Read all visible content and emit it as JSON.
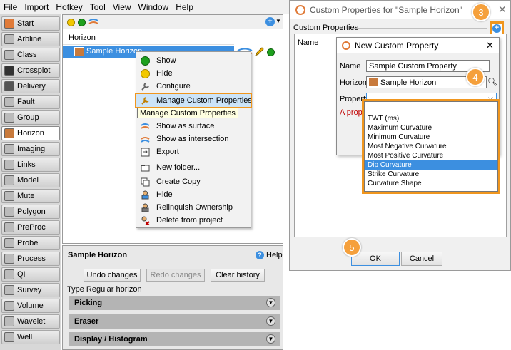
{
  "menubar": {
    "items": [
      "File",
      "Import",
      "Hotkey",
      "Tool",
      "View",
      "Window",
      "Help"
    ]
  },
  "tools": [
    "Start",
    "Arbline",
    "Class",
    "Crossplot",
    "Delivery",
    "Fault",
    "Group",
    "Horizon",
    "Imaging",
    "Links",
    "Model",
    "Mute",
    "Polygon",
    "PreProc",
    "Probe",
    "Process",
    "QI",
    "Survey",
    "Volume",
    "Wavelet",
    "Well"
  ],
  "selected_tool": "Horizon",
  "horizon_panel": {
    "column_header": "Horizon",
    "item_name": "Sample Horizon"
  },
  "context_menu": {
    "items": [
      {
        "label": "Show",
        "icon": "green-dot-icon"
      },
      {
        "label": "Hide",
        "icon": "yellow-dot-icon"
      },
      {
        "label": "Configure",
        "icon": "wrench-icon"
      },
      {
        "label": "Manage Custom Properties",
        "icon": "wrench-icon",
        "highlighted": true
      },
      {
        "label": "Show as surface",
        "icon": "surface-icon"
      },
      {
        "label": "Show as intersection",
        "icon": "intersection-icon"
      },
      {
        "label": "Export",
        "icon": "export-icon"
      },
      {
        "label": "New folder...",
        "icon": "folder-icon"
      },
      {
        "label": "Create Copy",
        "icon": "copy-icon"
      },
      {
        "label": "Hide",
        "icon": "user-icon"
      },
      {
        "label": "Relinquish Ownership",
        "icon": "user-release-icon"
      },
      {
        "label": "Delete from project",
        "icon": "delete-icon"
      }
    ],
    "tooltip": "Manage Custom Properties"
  },
  "details_panel": {
    "title": "Sample Horizon",
    "help_label": "Help",
    "undo_label": "Undo changes",
    "redo_label": "Redo changes",
    "clear_label": "Clear history",
    "type_text": "Type Regular horizon",
    "sections": [
      "Picking",
      "Eraser",
      "Display / Histogram"
    ]
  },
  "custom_properties_dialog": {
    "title": "Custom Properties for \"Sample Horizon\"",
    "group_label": "Custom Properties",
    "column_name": "Name",
    "ok_label": "OK",
    "cancel_label": "Cancel"
  },
  "new_property_dialog": {
    "title": "New Custom Property",
    "name_label": "Name",
    "name_value": "Sample Custom Property",
    "horizon_label": "Horizon",
    "horizon_value": "Sample Horizon",
    "property_label": "Property",
    "warning_fragment": "A prope"
  },
  "property_options": [
    "TWT (ms)",
    "Maximum Curvature",
    "Minimum Curvature",
    "Most Negative Curvature",
    "Most Positive Curvature",
    "Dip Curvature",
    "Strike Curvature",
    "Curvature Shape"
  ],
  "property_selected": "Dip Curvature",
  "callouts": [
    "3",
    "4",
    "5"
  ],
  "colors": {
    "accent": "#3c8fe0",
    "callout": "#f5a03c",
    "highlight_outline": "#f0961e",
    "warning": "#c00000"
  }
}
